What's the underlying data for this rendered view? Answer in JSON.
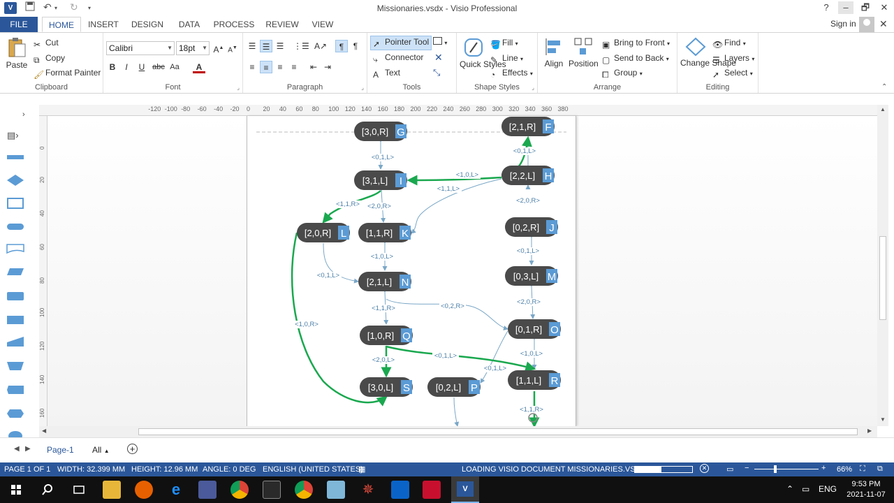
{
  "window": {
    "title": "Missionaries.vsdx - Visio Professional",
    "help": "?",
    "minimize": "–",
    "restore": "🗗",
    "close": "✕"
  },
  "tabs": [
    "FILE",
    "HOME",
    "INSERT",
    "DESIGN",
    "DATA",
    "PROCESS",
    "REVIEW",
    "VIEW"
  ],
  "active_tab": "HOME",
  "account": {
    "sign_in": "Sign in"
  },
  "ribbon": {
    "clipboard": {
      "label": "Clipboard",
      "paste": "Paste",
      "cut": "Cut",
      "copy": "Copy",
      "format_painter": "Format Painter"
    },
    "font": {
      "label": "Font",
      "font_name": "Calibri",
      "font_size": "18pt",
      "bold": "B",
      "italic": "I",
      "underline": "U",
      "strike": "abc",
      "case": "Aa",
      "color": "A"
    },
    "paragraph": {
      "label": "Paragraph"
    },
    "tools": {
      "label": "Tools",
      "pointer": "Pointer Tool",
      "connector": "Connector",
      "text": "Text"
    },
    "shape_styles": {
      "label": "Shape Styles",
      "quick_styles": "Quick Styles",
      "fill": "Fill",
      "line": "Line",
      "effects": "Effects"
    },
    "arrange": {
      "label": "Arrange",
      "align": "Align",
      "position": "Position",
      "bring_front": "Bring to Front",
      "send_back": "Send to Back",
      "group": "Group"
    },
    "editing": {
      "label": "Editing",
      "change_shape": "Change Shape",
      "find": "Find",
      "layers": "Layers",
      "select": "Select"
    }
  },
  "ruler": {
    "h_ticks": [
      "-120",
      "-100",
      "-80",
      "-60",
      "-40",
      "-20",
      "0",
      "20",
      "40",
      "60",
      "80",
      "100",
      "120",
      "140",
      "160",
      "180",
      "200",
      "220",
      "240",
      "260",
      "280",
      "300",
      "320",
      "340",
      "360",
      "380"
    ],
    "v_ticks": [
      "0",
      "20",
      "40",
      "60",
      "80",
      "100",
      "120",
      "140",
      "160"
    ]
  },
  "diagram": {
    "nodes": [
      {
        "id": "G",
        "label": "[3,0,R]"
      },
      {
        "id": "F",
        "label": "[2,1,R]"
      },
      {
        "id": "I",
        "label": "[3,1,L]"
      },
      {
        "id": "H",
        "label": "[2,2,L]"
      },
      {
        "id": "L",
        "label": "[2,0,R]"
      },
      {
        "id": "K",
        "label": "[1,1,R]"
      },
      {
        "id": "J",
        "label": "[0,2,R]"
      },
      {
        "id": "N",
        "label": "[2,1,L]"
      },
      {
        "id": "M",
        "label": "[0,3,L]"
      },
      {
        "id": "Q",
        "label": "[1,0,R]"
      },
      {
        "id": "O",
        "label": "[0,1,R]"
      },
      {
        "id": "S",
        "label": "[3,0,L]"
      },
      {
        "id": "P",
        "label": "[0,2,L]"
      },
      {
        "id": "R",
        "label": "[1,1,L]"
      }
    ],
    "edge_labels": [
      "<0,1,L>",
      "<0,1,L>",
      "<1,0,L>",
      "<1,1,L>",
      "<1,1,R>",
      "<2,0,R>",
      "<2,0,R>",
      "<0,1,L>",
      "<1,0,L>",
      "<0,1,L>",
      "<0,2,R>",
      "<1,1,R>",
      "<2,0,R>",
      "<1,0,R>",
      "<1,0,L>",
      "<2,0,L>",
      "<0,1,L>",
      "<0,1,L>",
      "<1,1,R>"
    ],
    "colors": {
      "node": "#4a4a4a",
      "badge": "#5b9bd5",
      "edge": "#7aa7c7",
      "solution": "#1aa84f"
    }
  },
  "page_tabs": {
    "page1": "Page-1",
    "all": "All",
    "add": "+"
  },
  "status": {
    "page": "PAGE 1 OF 1",
    "width": "WIDTH: 32.399 MM",
    "height": "HEIGHT: 12.96 MM",
    "angle": "ANGLE: 0 DEG",
    "language": "ENGLISH (UNITED STATES)",
    "loading": "LOADING VISIO DOCUMENT MISSIONARIES.VSDX...",
    "zoom": "66%",
    "zoom_progress": 0.46
  },
  "taskbar": {
    "lang": "ENG",
    "time": "9:53 PM",
    "date": "2021-11-07"
  }
}
